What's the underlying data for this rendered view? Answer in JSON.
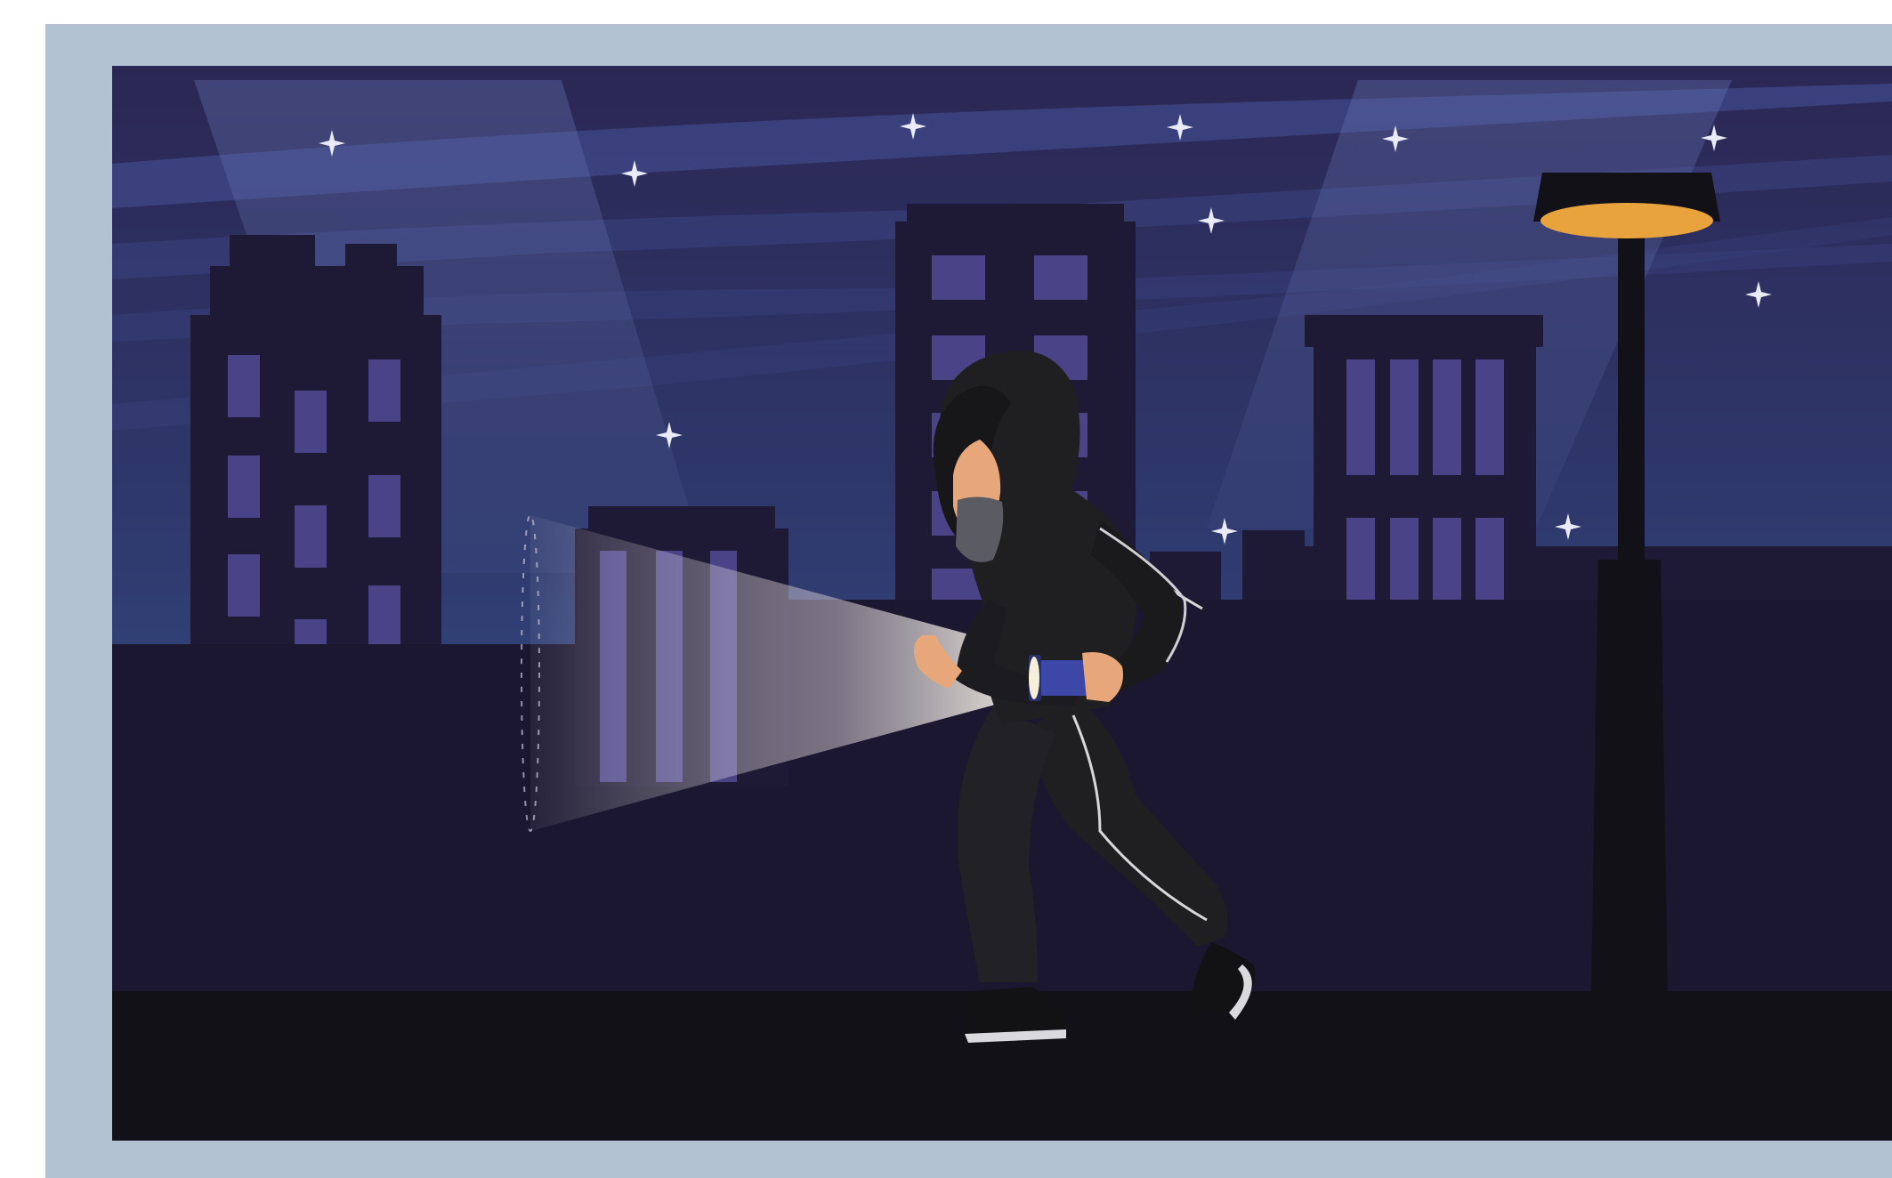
{
  "scene": {
    "subject": "hooded-figure-with-flashlight",
    "colors": {
      "frame": "#b3c2d3",
      "sky_top": "#2b2754",
      "sky_bottom": "#35508a",
      "building": "#1e1934",
      "window": "#4b4388",
      "ground": "#121118",
      "lamp_light": "#e9a33c",
      "clothing": "#1f1f22",
      "skin": "#e8a77a"
    },
    "icons": [
      "star-icon",
      "street-lamp-icon",
      "flashlight-icon"
    ]
  }
}
